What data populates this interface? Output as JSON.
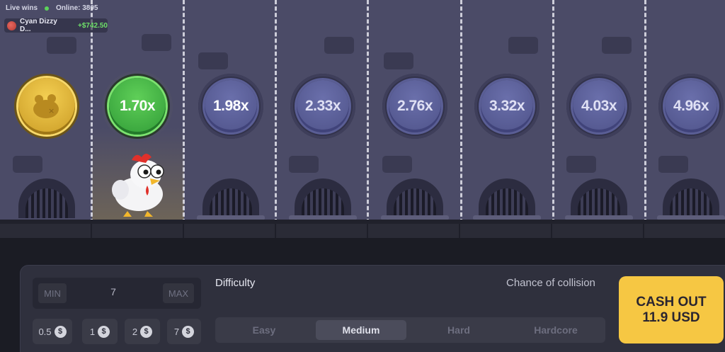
{
  "feed": {
    "live_wins_label": "Live wins",
    "online_label": "Online: 3805",
    "recent_win": {
      "player": "Cyan Dizzy D...",
      "amount": "+$742.50"
    }
  },
  "lanes": {
    "multipliers": [
      "1.70x",
      "1.98x",
      "2.33x",
      "2.76x",
      "3.32x",
      "4.03x",
      "4.96x"
    ],
    "current_index": 0
  },
  "bet": {
    "min_label": "MIN",
    "max_label": "MAX",
    "value": "7",
    "quick_amounts": [
      "0.5",
      "1",
      "2",
      "7"
    ]
  },
  "difficulty": {
    "title": "Difficulty",
    "chance_label": "Chance of collision",
    "options": [
      "Easy",
      "Medium",
      "Hard",
      "Hardcore"
    ],
    "selected": "Medium"
  },
  "cashout": {
    "line1": "CASH OUT",
    "line2": "11.9 USD"
  },
  "colors": {
    "accent": "#f6c743",
    "win_green": "#6fe06a",
    "field": "#4b4b67"
  }
}
